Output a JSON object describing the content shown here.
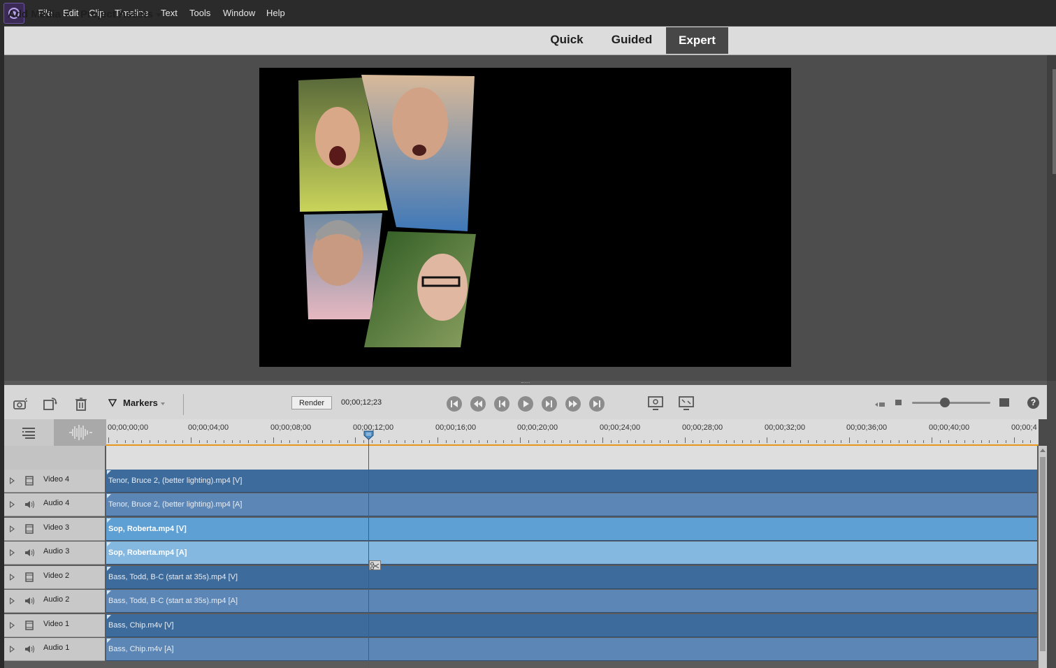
{
  "menu": {
    "items": [
      "File",
      "Edit",
      "Clip",
      "Timeline",
      "Text",
      "Tools",
      "Window",
      "Help"
    ]
  },
  "action_bar": {
    "add_media": "Add Media",
    "project_assets": "Project Assets",
    "modes": [
      "Quick",
      "Guided",
      "Expert"
    ],
    "active_mode": "Expert"
  },
  "timeline_toolbar": {
    "markers_label": "Markers",
    "render_label": "Render",
    "timecode": "00;00;12;23",
    "zoom_level": 0.42
  },
  "ruler": {
    "labels": [
      "00;00;00;00",
      "00;00;04;00",
      "00;00;08;00",
      "00;00;12;00",
      "00;00;16;00",
      "00;00;20;00",
      "00;00;24;00",
      "00;00;28;00",
      "00;00;32;00",
      "00;00;36;00",
      "00;00;40;00",
      "00;00;4"
    ]
  },
  "tracks": [
    {
      "name": "Video 4",
      "kind": "video",
      "clip": "Tenor, Bruce 2, (better lighting).mp4 [V]",
      "selected": false
    },
    {
      "name": "Audio 4",
      "kind": "audio",
      "clip": "Tenor, Bruce 2, (better lighting).mp4 [A]",
      "selected": false
    },
    {
      "name": "Video 3",
      "kind": "video",
      "clip": "Sop, Roberta.mp4 [V]",
      "selected": true
    },
    {
      "name": "Audio 3",
      "kind": "audio",
      "clip": "Sop, Roberta.mp4 [A]",
      "selected": true
    },
    {
      "name": "Video 2",
      "kind": "video",
      "clip": "Bass, Todd, B-C (start at 35s).mp4 [V]",
      "selected": false
    },
    {
      "name": "Audio 2",
      "kind": "audio",
      "clip": "Bass, Todd, B-C (start at 35s).mp4 [A]",
      "selected": false
    },
    {
      "name": "Video 1",
      "kind": "video",
      "clip": "Bass, Chip.m4v [V]",
      "selected": false
    },
    {
      "name": "Audio 1",
      "kind": "audio",
      "clip": "Bass, Chip.m4v [A]",
      "selected": false
    }
  ],
  "colors": {
    "video_clip": "#3d6b9c",
    "audio_clip": "#5b86b5",
    "video_clip_selected": "#5e9fd4",
    "audio_clip_selected": "#85b8e0",
    "playhead": "#d0242a",
    "ruler_accent": "#e8961e"
  },
  "icons": {
    "transport": [
      "go-to-start-icon",
      "step-back-icon",
      "frame-back-icon",
      "play-icon",
      "frame-forward-icon",
      "step-forward-icon",
      "go-to-end-icon"
    ]
  }
}
